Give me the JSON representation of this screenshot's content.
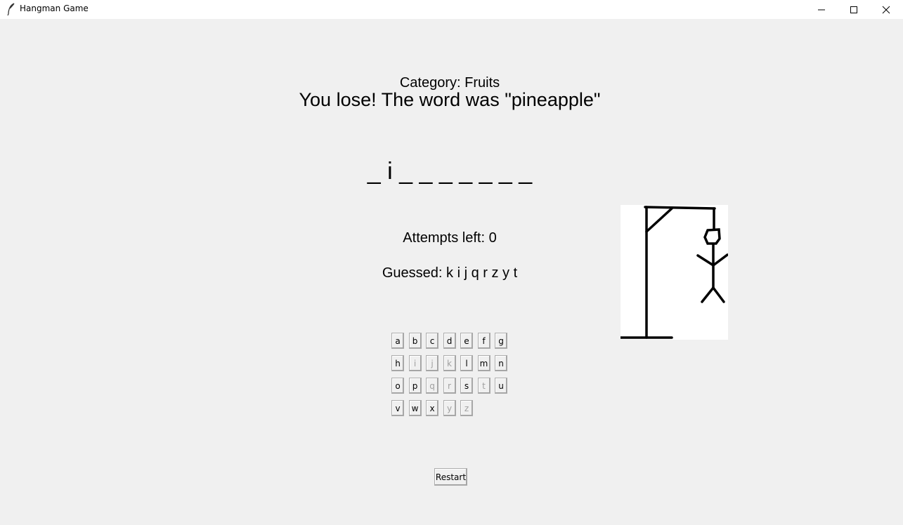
{
  "window": {
    "title": "Hangman Game",
    "icon": "feather-icon",
    "controls": [
      "minimize-icon",
      "maximize-icon",
      "close-icon"
    ]
  },
  "game": {
    "category": "Category: Fruits",
    "message": "You lose! The word was \"pineapple\"",
    "word_display": "_ i _ _ _ _ _ _ _",
    "attempts": "Attempts left: 0",
    "guessed": "Guessed: k i j q r z y t"
  },
  "keyboard": {
    "rows": [
      [
        "a",
        "b",
        "c",
        "d",
        "e",
        "f",
        "g"
      ],
      [
        "h",
        "i",
        "j",
        "k",
        "l",
        "m",
        "n"
      ],
      [
        "o",
        "p",
        "q",
        "r",
        "s",
        "t",
        "u"
      ],
      [
        "v",
        "w",
        "x",
        "y",
        "z"
      ]
    ],
    "disabled": [
      "i",
      "j",
      "k",
      "q",
      "r",
      "t",
      "y",
      "z"
    ]
  },
  "restart_label": "Restart",
  "hangman": {
    "stage": "complete",
    "line_color": "#000000"
  }
}
